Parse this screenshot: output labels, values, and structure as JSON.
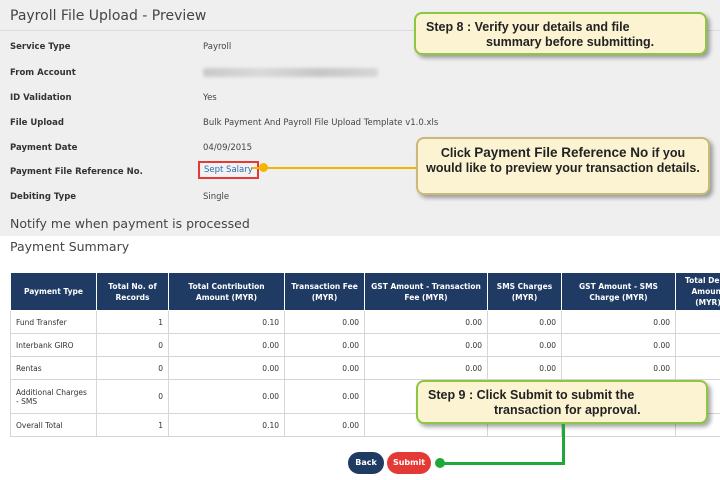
{
  "page": {
    "title": "Payroll File Upload - Preview"
  },
  "details": {
    "service_type": {
      "label": "Service Type",
      "value": "Payroll"
    },
    "from_account": {
      "label": "From Account",
      "value": ""
    },
    "id_validation": {
      "label": "ID Validation",
      "value": "Yes"
    },
    "file_upload": {
      "label": "File Upload",
      "value": "Bulk Payment And Payroll File Upload Template v1.0.xls"
    },
    "payment_date": {
      "label": "Payment Date",
      "value": "04/09/2015"
    },
    "payment_ref": {
      "label": "Payment File Reference No.",
      "value": "Sept Salary"
    },
    "debiting_type": {
      "label": "Debiting Type",
      "value": "Single"
    }
  },
  "notify_text": "Notify me when payment is processed",
  "summary": {
    "title": "Payment Summary",
    "headers": [
      "Payment Type",
      "Total No. of Records",
      "Total Contribution Amount (MYR)",
      "Transaction Fee (MYR)",
      "GST Amount - Transaction Fee (MYR)",
      "SMS Charges (MYR)",
      "GST Amount - SMS Charge (MYR)",
      "Total Debit Amount (MYR)"
    ],
    "rows": [
      [
        "Fund Transfer",
        "1",
        "0.10",
        "0.00",
        "0.00",
        "0.00",
        "0.00",
        ""
      ],
      [
        "Interbank GIRO",
        "0",
        "0.00",
        "0.00",
        "0.00",
        "0.00",
        "0.00",
        ""
      ],
      [
        "Rentas",
        "0",
        "0.00",
        "0.00",
        "0.00",
        "0.00",
        "0.00",
        ""
      ],
      [
        "Additional Charges - SMS",
        "0",
        "0.00",
        "0.00",
        "",
        "",
        "",
        ""
      ],
      [
        "Overall Total",
        "1",
        "0.10",
        "0.00",
        "",
        "",
        "",
        ""
      ]
    ]
  },
  "buttons": {
    "back": "Back",
    "submit": "Submit"
  },
  "callouts": {
    "step8": {
      "line1": "Step 8 :  Verify your details and file",
      "line2": "summary  before submitting."
    },
    "payref": {
      "pre": "Click ",
      "emph": "Payment File Reference No",
      "post": " if you would like to preview your transaction details."
    },
    "step9": {
      "pre": "Step 9 :  Click ",
      "emph": "Submit",
      "post": " to submit the",
      "line2": "transaction for approval."
    }
  },
  "colors": {
    "header_navy": "#1f3a63",
    "submit_red": "#e53935",
    "connector_green": "#1fa83a",
    "connector_amber": "#f2b500",
    "callout_fill": "#fbf3d2"
  }
}
